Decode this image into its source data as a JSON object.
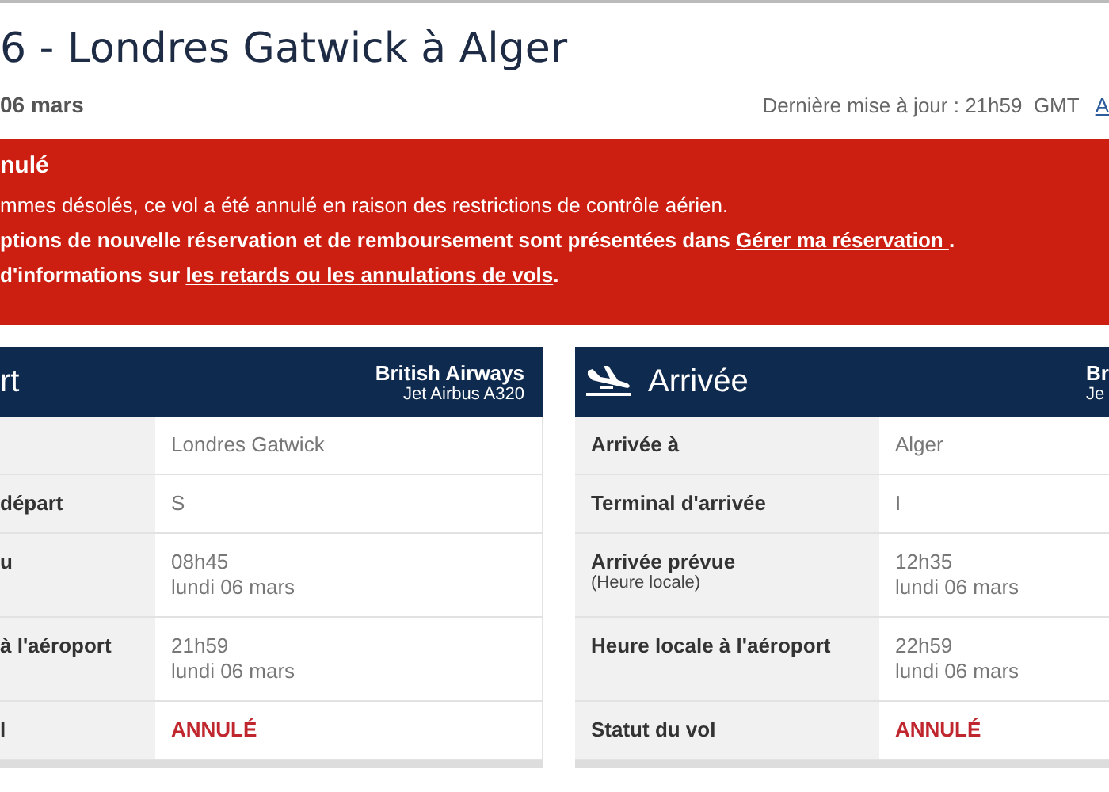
{
  "header": {
    "title": "6 - Londres Gatwick à Alger",
    "date": "06 mars",
    "updated": "Dernière mise à jour : 21h59  GMT",
    "updated_link": "A"
  },
  "alert": {
    "title": "nulé",
    "lines": [
      {
        "kind": "note",
        "text": "mmes désolés, ce vol a été annulé en raison des restrictions de contrôle aérien."
      },
      {
        "kind": "action",
        "text": "ptions de nouvelle réservation et de remboursement sont présentées dans ",
        "link": "Gérer ma réservation ",
        "after": "."
      },
      {
        "kind": "action",
        "text": "d'informations sur ",
        "link": "les retards ou les annulations de vols",
        "after": "."
      }
    ]
  },
  "cards": [
    {
      "title": "rt",
      "airline": "British Airways",
      "aircraft": "Jet Airbus A320",
      "rows": [
        {
          "kind": "plain",
          "values": [
            "Londres Gatwick"
          ]
        },
        {
          "kind": "plain",
          "label": "départ",
          "values": [
            "S"
          ]
        },
        {
          "kind": "plain",
          "label": "u",
          "values": [
            "08h45",
            "lundi 06 mars"
          ]
        },
        {
          "kind": "plain",
          "label": "à l'aéroport",
          "values": [
            "21h59",
            "lundi 06 mars"
          ]
        },
        {
          "kind": "status",
          "label": "l",
          "values": [
            "ANNULÉ"
          ]
        }
      ]
    },
    {
      "title": "Arrivée",
      "airline": "Br",
      "aircraft": "Je",
      "rows": [
        {
          "kind": "plain",
          "label": "Arrivée à",
          "values": [
            "Alger"
          ]
        },
        {
          "kind": "plain",
          "label": "Terminal d'arrivée",
          "values": [
            "I"
          ]
        },
        {
          "kind": "plain",
          "label": "Arrivée prévue",
          "sublabel": "(Heure locale)",
          "values": [
            "12h35",
            "lundi 06 mars"
          ]
        },
        {
          "kind": "plain",
          "label": "Heure locale à l'aéroport",
          "values": [
            "22h59",
            "lundi 06 mars"
          ]
        },
        {
          "kind": "status",
          "label": "Statut du vol",
          "values": [
            "ANNULÉ"
          ]
        }
      ]
    }
  ]
}
